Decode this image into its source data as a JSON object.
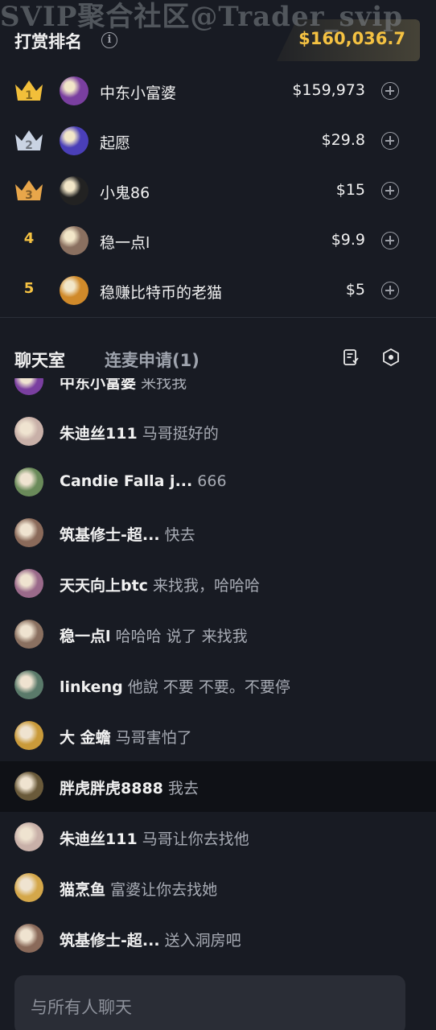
{
  "watermark": "SVIP聚合社区@Trader_svip",
  "ranking": {
    "title": "打赏排名",
    "info_icon": "info-icon",
    "total": "$160,036.7",
    "rows": [
      {
        "rank": "1",
        "badge": "gold-crown",
        "name": "中东小富婆",
        "amount": "$159,973",
        "avatar_color": "#7a3fa0"
      },
      {
        "rank": "2",
        "badge": "silver-crown",
        "name": "起愿",
        "amount": "$29.8",
        "avatar_color": "#4a3fb8"
      },
      {
        "rank": "3",
        "badge": "bronze-crown",
        "name": "小鬼86",
        "amount": "$15",
        "avatar_color": "#222222"
      },
      {
        "rank": "4",
        "badge": "",
        "name": "稳一点l",
        "amount": "$9.9",
        "avatar_color": "#8a7060"
      },
      {
        "rank": "5",
        "badge": "",
        "name": "稳赚比特币的老猫",
        "amount": "$5",
        "avatar_color": "#d08a2a"
      }
    ]
  },
  "chat": {
    "tab_chat": "聊天室",
    "tab_mic": "连麦申请(1)",
    "icons": [
      "notes-icon",
      "settings-icon"
    ],
    "messages": [
      {
        "user": "中东小富婆",
        "text": "来找我",
        "avatar_color": "#7a3fa0"
      },
      {
        "user": "朱迪丝111",
        "text": "马哥挺好的",
        "avatar_color": "#c8b0a8"
      },
      {
        "user": "Candie Falla j...",
        "text": "666",
        "avatar_color": "#6a8a5a"
      },
      {
        "user": "筑基修士-超...",
        "text": "快去",
        "avatar_color": "#8a6a5a"
      },
      {
        "user": "天天向上btc",
        "text": "来找我，哈哈哈",
        "avatar_color": "#9a6a8a"
      },
      {
        "user": "稳一点l",
        "text": "哈哈哈 说了 来找我",
        "avatar_color": "#8a7060"
      },
      {
        "user": "linkeng",
        "text": "他說 不要 不要。不要停",
        "avatar_color": "#5a7a6a"
      },
      {
        "user": "大 金蟾",
        "text": "马哥害怕了",
        "avatar_color": "#c99a3a"
      },
      {
        "user": "胖虎胖虎8888",
        "text": "我去",
        "avatar_color": "#6a5a3a"
      },
      {
        "user": "朱迪丝111",
        "text": "马哥让你去找他",
        "avatar_color": "#c8b0a8"
      },
      {
        "user": "猫烹鱼",
        "text": "富婆让你去找她",
        "avatar_color": "#d4a74a"
      },
      {
        "user": "筑基修士-超...",
        "text": "送入洞房吧",
        "avatar_color": "#8a6a5a"
      }
    ],
    "highlighted_index": 8,
    "input_placeholder": "与所有人聊天"
  },
  "colors": {
    "accent_gold": "#f5c242",
    "background": "#181b23"
  }
}
